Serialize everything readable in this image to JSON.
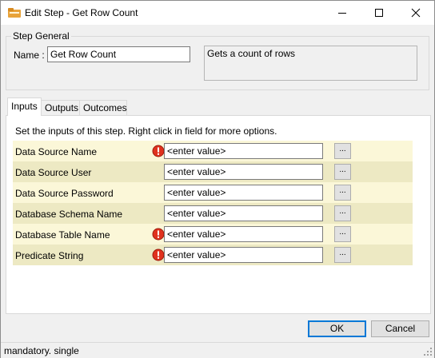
{
  "window": {
    "title": "Edit Step - Get Row Count",
    "icon": "folder-step-icon"
  },
  "step_general": {
    "legend": "Step General",
    "name_label": "Name :",
    "name_value": "Get Row Count",
    "description": "Gets a count of rows"
  },
  "tabs": [
    {
      "label": "Inputs",
      "active": true
    },
    {
      "label": "Outputs",
      "active": false
    },
    {
      "label": "Outcomes",
      "active": false
    }
  ],
  "inputs": {
    "instructions": "Set the inputs of this step.  Right click in field for more options.",
    "rows": [
      {
        "label": "Data Source Name",
        "value": "<enter value>",
        "mandatory": true,
        "browse": "..."
      },
      {
        "label": "Data Source User",
        "value": "<enter value>",
        "mandatory": false,
        "browse": "..."
      },
      {
        "label": "Data Source Password",
        "value": "<enter value>",
        "mandatory": false,
        "browse": "..."
      },
      {
        "label": "Database Schema Name",
        "value": "<enter value>",
        "mandatory": false,
        "browse": "..."
      },
      {
        "label": "Database Table Name",
        "value": "<enter value>",
        "mandatory": true,
        "browse": "..."
      },
      {
        "label": "Predicate String",
        "value": "<enter value>",
        "mandatory": true,
        "browse": "..."
      }
    ]
  },
  "buttons": {
    "ok": "OK",
    "cancel": "Cancel"
  },
  "status": {
    "text": "mandatory. single"
  },
  "colors": {
    "row_light": "#fbf7d8",
    "row_dark": "#ede9c3",
    "mandatory": "#e0321e",
    "accent": "#0078d7"
  }
}
